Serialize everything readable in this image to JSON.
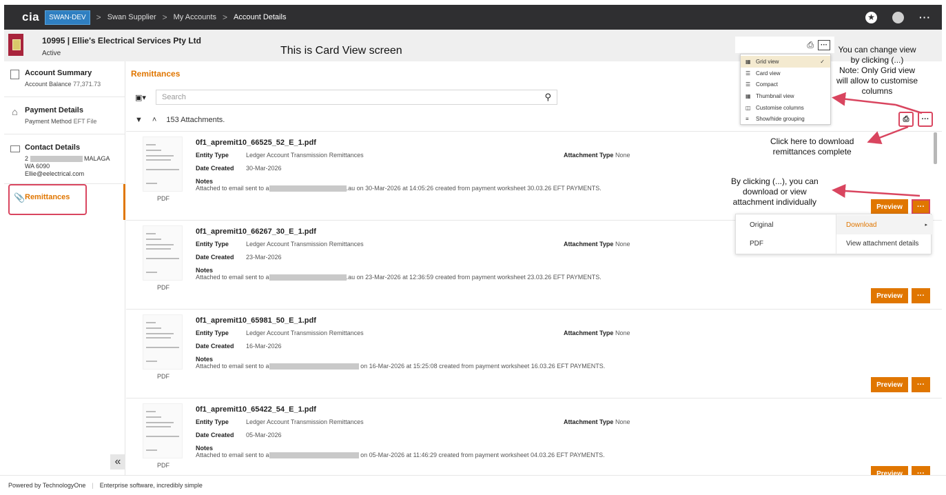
{
  "topbar": {
    "logo": "cia",
    "env": "SWAN-DEV",
    "breadcrumbs": [
      "Swan Supplier",
      "My Accounts",
      "Account Details"
    ],
    "accessibility_glyph": "★",
    "more_glyph": "···"
  },
  "header": {
    "title": "10995 | Ellie's Electrical Services Pty Ltd",
    "status": "Active",
    "print_glyph": "⎙",
    "more_glyph": "···"
  },
  "annotations": {
    "screen_title": "This is Card View screen",
    "change_view": [
      "You can change view",
      "by clicking (...)",
      "Note: Only Grid view",
      "will allow to customise",
      "columns"
    ],
    "download_complete": [
      "Click here to download",
      "remittances complete"
    ],
    "download_individual": [
      "By clicking (...), you can",
      "download or view",
      "attachment individually"
    ]
  },
  "sidebar": {
    "items": [
      {
        "label": "Account Summary",
        "sub_label": "Account Balance",
        "sub_value": "77,371.73"
      },
      {
        "label": "Payment Details",
        "sub_label": "Payment Method",
        "sub_value": "EFT File"
      },
      {
        "label": "Contact Details",
        "address_line1_start": "2",
        "address_line1_end": "MALAGA",
        "address_line2": "WA 6090",
        "email": "Ellie@eelectrical.com"
      },
      {
        "label": "Remittances"
      }
    ],
    "collapse_glyph": "«"
  },
  "main": {
    "section_title": "Remittances",
    "search_placeholder": "Search",
    "attachments_count": "153 Attachments.",
    "preview_label": "Preview",
    "more_glyph": "···",
    "pdf_label": "PDF",
    "labels": {
      "entity_type": "Entity Type",
      "date_created": "Date Created",
      "attachment_type": "Attachment Type",
      "notes": "Notes"
    },
    "cards": [
      {
        "title": "0f1_apremit10_66525_52_E_1.pdf",
        "entity_type": "Ledger Account Transmission Remittances",
        "date_created": "30-Mar-2026",
        "attachment_type": "None",
        "notes_start": "Attached to email sent to a",
        "notes_end": ".au on 30-Mar-2026 at 14:05:26 created from payment worksheet 30.03.26 EFT PAYMENTS."
      },
      {
        "title": "0f1_apremit10_66267_30_E_1.pdf",
        "entity_type": "Ledger Account Transmission Remittances",
        "date_created": "23-Mar-2026",
        "attachment_type": "None",
        "notes_start": "Attached to email sent to a",
        "notes_end": ".au on 23-Mar-2026 at 12:36:59 created from payment worksheet 23.03.26 EFT PAYMENTS."
      },
      {
        "title": "0f1_apremit10_65981_50_E_1.pdf",
        "entity_type": "Ledger Account Transmission Remittances",
        "date_created": "16-Mar-2026",
        "attachment_type": "None",
        "notes_start": "Attached to email sent to a",
        "notes_end": " on 16-Mar-2026 at 15:25:08 created from payment worksheet 16.03.26 EFT PAYMENTS."
      },
      {
        "title": "0f1_apremit10_65422_54_E_1.pdf",
        "entity_type": "Ledger Account Transmission Remittances",
        "date_created": "05-Mar-2026",
        "attachment_type": "None",
        "notes_start": "Attached to email sent to a",
        "notes_end": " on 05-Mar-2026 at 11:46:29 created from payment worksheet 04.03.26 EFT PAYMENTS."
      }
    ]
  },
  "view_menu": {
    "items": [
      "Grid view",
      "Card view",
      "Compact",
      "Thumbnail view",
      "Customise columns",
      "Show/hide grouping"
    ],
    "selected_index": 0,
    "check_glyph": "✓"
  },
  "download_menu": {
    "left_items": [
      "Original",
      "PDF"
    ],
    "right_items": [
      "Download",
      "View attachment details"
    ],
    "arrow_glyph": "▸"
  },
  "footer": {
    "powered_by": "Powered by TechnologyOne",
    "tagline": "Enterprise software, incredibly simple"
  },
  "colors": {
    "accent": "#e07600",
    "topbar": "#2f2f31",
    "annotation_red": "#d9455f",
    "env_badge": "#2f7fc1"
  }
}
